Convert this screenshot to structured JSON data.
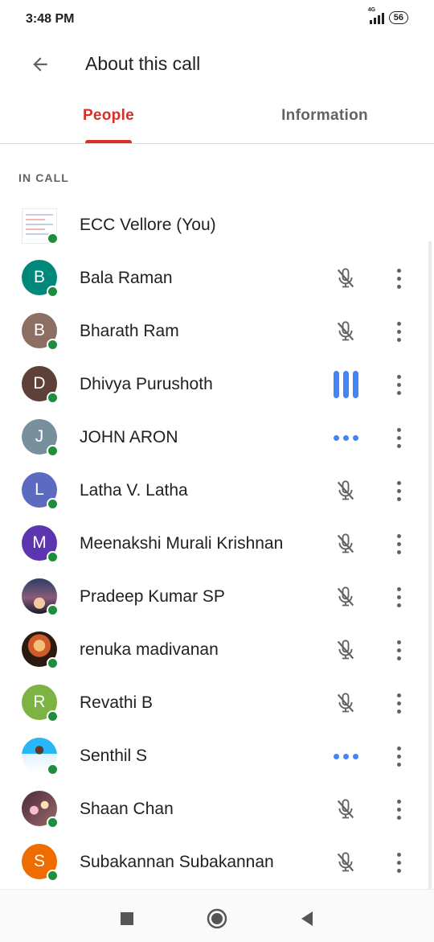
{
  "status": {
    "time": "3:48 PM",
    "network": "4G",
    "battery": "56"
  },
  "header": {
    "title": "About this call",
    "back_icon": "arrow-back-icon"
  },
  "tabs": [
    {
      "label": "People",
      "active": true
    },
    {
      "label": "Information",
      "active": false
    }
  ],
  "section_header": "IN CALL",
  "colors": {
    "accent": "#d93025",
    "presence": "#1e8e3e",
    "audio_active": "#4285f4"
  },
  "participants": [
    {
      "name": "ECC Vellore (You)",
      "avatar_letter": "",
      "avatar_type": "document-thumbnail",
      "audio_state": "none"
    },
    {
      "name": "Bala Raman",
      "avatar_letter": "B",
      "avatar_color": "#00897b",
      "audio_state": "muted"
    },
    {
      "name": "Bharath Ram",
      "avatar_letter": "B",
      "avatar_color": "#8d6e63",
      "audio_state": "muted"
    },
    {
      "name": "Dhivya Purushoth",
      "avatar_letter": "D",
      "avatar_color": "#5d4037",
      "audio_state": "speaking"
    },
    {
      "name": "JOHN ARON",
      "avatar_letter": "J",
      "avatar_color": "#78909c",
      "audio_state": "idle-dots"
    },
    {
      "name": "Latha V. Latha",
      "avatar_letter": "L",
      "avatar_color": "#5c6bc0",
      "audio_state": "muted"
    },
    {
      "name": "Meenakshi Murali Krishnan",
      "avatar_letter": "M",
      "avatar_color": "#5e35b1",
      "audio_state": "muted"
    },
    {
      "name": "Pradeep Kumar SP",
      "avatar_letter": "",
      "avatar_type": "photo-sunset",
      "audio_state": "muted"
    },
    {
      "name": "renuka madivanan",
      "avatar_letter": "",
      "avatar_type": "photo-deity",
      "audio_state": "muted"
    },
    {
      "name": "Revathi B",
      "avatar_letter": "R",
      "avatar_color": "#7cb342",
      "audio_state": "muted"
    },
    {
      "name": "Senthil S",
      "avatar_letter": "",
      "avatar_type": "photo-person",
      "audio_state": "idle-dots"
    },
    {
      "name": "Shaan Chan",
      "avatar_letter": "",
      "avatar_type": "photo-bokeh",
      "audio_state": "muted"
    },
    {
      "name": "Subakannan Subakannan",
      "avatar_letter": "S",
      "avatar_color": "#ef6c00",
      "audio_state": "muted"
    }
  ],
  "nav": {
    "recents_icon": "square-recents-icon",
    "home_icon": "circle-home-icon",
    "back_icon": "triangle-back-icon"
  }
}
